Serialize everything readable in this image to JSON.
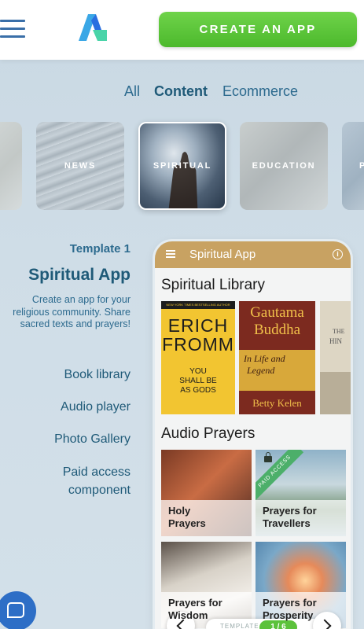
{
  "header": {
    "create_button": "CREATE AN APP"
  },
  "tabs": [
    {
      "label": "All"
    },
    {
      "label": "Content"
    },
    {
      "label": "Ecommerce"
    }
  ],
  "categories": [
    {
      "label": ""
    },
    {
      "label": "NEWS"
    },
    {
      "label": "SPIRITUAL"
    },
    {
      "label": "EDUCATION"
    },
    {
      "label": "P"
    }
  ],
  "template": {
    "label": "Template 1",
    "title": "Spiritual App",
    "description": "Create an app for your religious community. Share sacred texts and prayers!",
    "features": [
      "Book library",
      "Audio player",
      "Photo Gallery",
      "Paid access component"
    ]
  },
  "phone": {
    "app_title": "Spiritual App",
    "library_title": "Spiritual Library",
    "audio_title": "Audio Prayers",
    "books": [
      {
        "banner": "NEW YORK TIMES BESTSELLING AUTHOR",
        "line1": "ERICH",
        "line2": "FROMM",
        "sub1": "YOU",
        "sub2": "SHALL BE",
        "sub3": "AS GODS"
      },
      {
        "title1": "Gautama",
        "title2": "Buddha",
        "sub1": "In Life and",
        "sub2": "Legend",
        "author": "Betty Kelen"
      },
      {
        "title1": "THE",
        "title2": "HIN"
      }
    ],
    "audio": [
      {
        "line1": "Holy",
        "line2": "Prayers",
        "paid": false
      },
      {
        "line1": "Prayers for",
        "line2": "Travellers",
        "paid": true
      },
      {
        "line1": "Prayers for",
        "line2": "Wisdom",
        "paid": false
      },
      {
        "line1": "Prayers for",
        "line2": "Prosperity",
        "paid": false
      }
    ],
    "paid_label": "PAID ACCESS"
  },
  "pager": {
    "label": "TEMPLATE",
    "count": "1 / 6"
  },
  "colors": {
    "accent_green": "#5cc23c",
    "phone_header": "#c8a262",
    "primary_text": "#1f5a78",
    "chat_blue": "#2d6ec6"
  }
}
